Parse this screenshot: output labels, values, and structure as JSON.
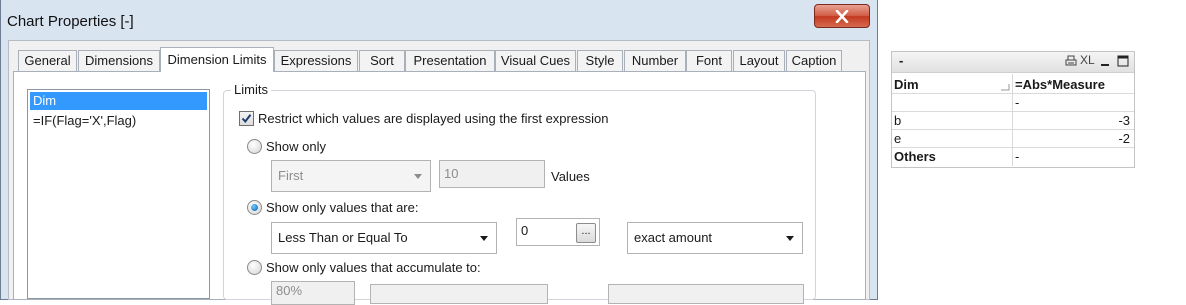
{
  "dialog": {
    "title": "Chart Properties [-]",
    "close_glyph": "X",
    "tabs": [
      {
        "label": "General"
      },
      {
        "label": "Dimensions"
      },
      {
        "label": "Dimension Limits"
      },
      {
        "label": "Expressions"
      },
      {
        "label": "Sort"
      },
      {
        "label": "Presentation"
      },
      {
        "label": "Visual Cues"
      },
      {
        "label": "Style"
      },
      {
        "label": "Number"
      },
      {
        "label": "Font"
      },
      {
        "label": "Layout"
      },
      {
        "label": "Caption"
      }
    ],
    "active_tab": "Dimension Limits",
    "dimension_list": {
      "items": [
        "Dim",
        "=IF(Flag='X',Flag)"
      ],
      "selected": "Dim"
    },
    "limits": {
      "group_label": "Limits",
      "restrict_checkbox": {
        "label": "Restrict which values are displayed using the first expression",
        "checked": true
      },
      "show_only": {
        "label": "Show only",
        "selected": false,
        "mode_value": "First",
        "count_value": "10",
        "values_label": "Values"
      },
      "show_values_that_are": {
        "label": "Show only values that are:",
        "selected": true,
        "comparison_value": "Less Than or Equal To",
        "threshold_value": "0",
        "ellipsis_label": "...",
        "amount_mode_value": "exact amount"
      },
      "accumulate": {
        "label": "Show only values that accumulate to:",
        "selected": false,
        "percent_value": "80%"
      }
    }
  },
  "table_object": {
    "caption": {
      "title": "-",
      "xl_label": "XL",
      "icons": [
        "print-icon",
        "xl-icon",
        "minimize-icon",
        "maximize-icon"
      ]
    },
    "headers": [
      "Dim",
      "=Abs*Measure"
    ],
    "rows": [
      [
        "",
        "-"
      ],
      [
        "b",
        "-3"
      ],
      [
        "e",
        "-2"
      ],
      [
        "Others",
        "-"
      ]
    ]
  },
  "colors": {
    "dialog_frame": "#d9e4f1",
    "close_button": "#c3381f",
    "selection": "#3399ff",
    "radio_fill": "#0a57a8"
  }
}
